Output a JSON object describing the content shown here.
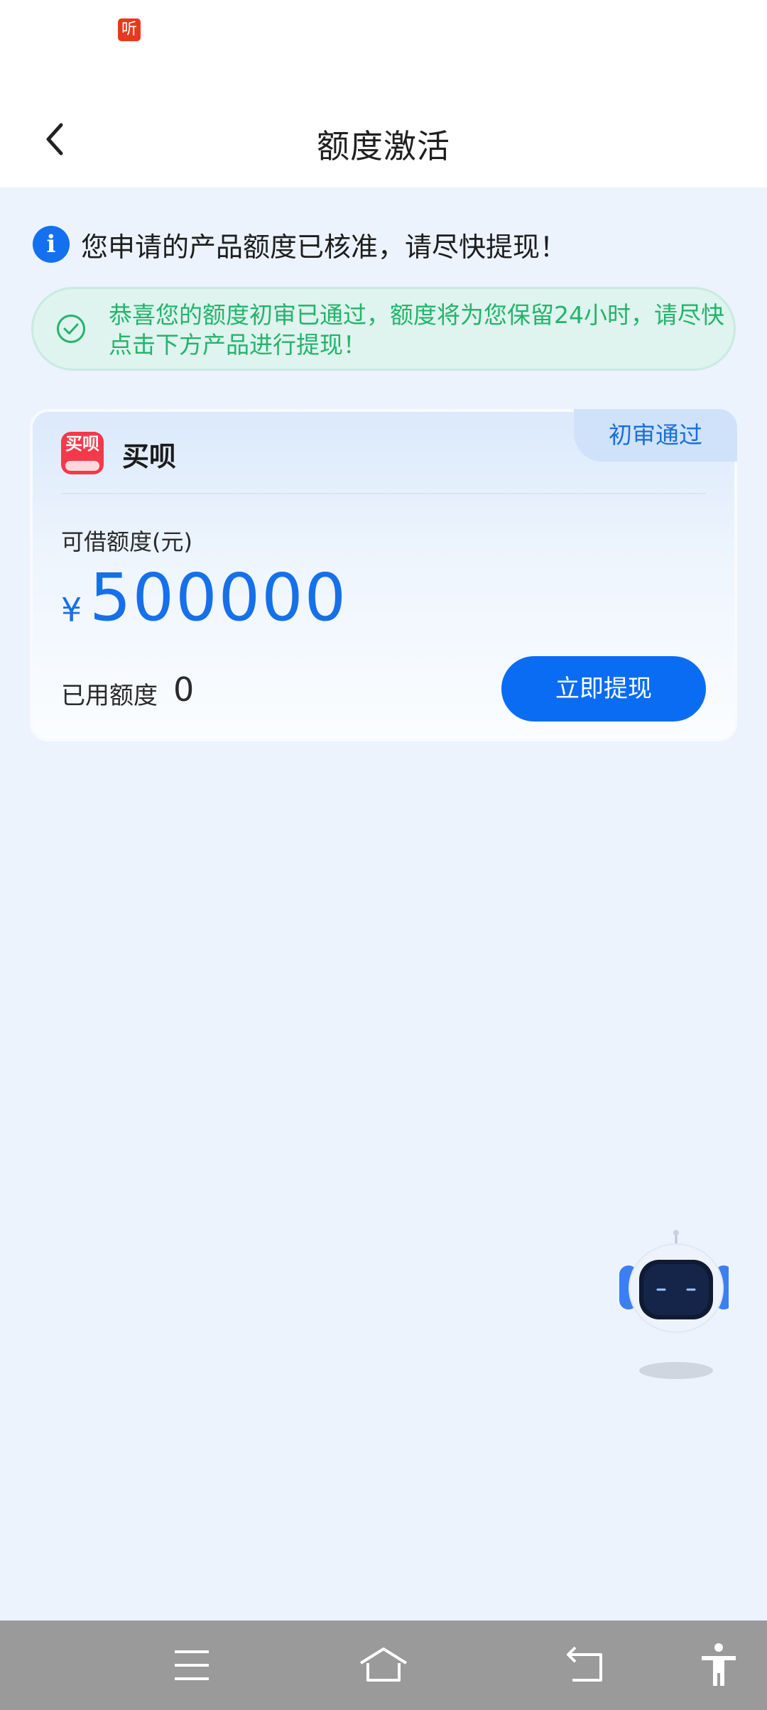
{
  "status_bar": {
    "badge_text": "听"
  },
  "header": {
    "title": "额度激活",
    "back_icon": "chevron-left-icon"
  },
  "notice": {
    "icon": "info-icon",
    "text": "您申请的产品额度已核准，请尽快提现！"
  },
  "success_banner": {
    "icon": "check-circle-icon",
    "text": "恭喜您的额度初审已通过，额度将为您保留24小时，请尽快点击下方产品进行提现！"
  },
  "product_card": {
    "status_tag": "初审通过",
    "app_logo_text": "买呗",
    "app_name": "买呗",
    "limit_label": "可借额度(元)",
    "currency_symbol": "¥",
    "amount": "500000",
    "used_label": "已用额度",
    "used_value": "0",
    "withdraw_button": "立即提现"
  },
  "assistant": {
    "icon": "robot-assistant-icon"
  },
  "navigation_bar": {
    "menu_icon": "menu-icon",
    "home_icon": "home-icon",
    "back_icon": "back-icon",
    "accessibility_icon": "accessibility-icon"
  },
  "colors": {
    "page_bg": "#ecf3fd",
    "accent": "#0a6cf2",
    "amount": "#1670ea",
    "success": "#23b46a",
    "status_badge": "#e8391f",
    "app_logo": "#f23a4b",
    "nav_bar": "#9a9a9a"
  }
}
